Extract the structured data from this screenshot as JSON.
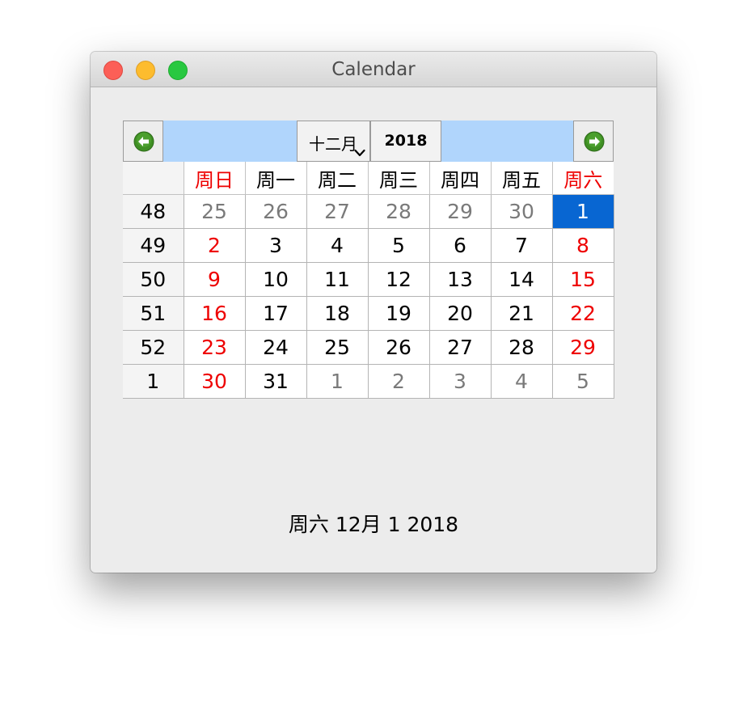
{
  "window": {
    "title": "Calendar"
  },
  "calendar": {
    "month_label": "十二月",
    "year_label": "2018",
    "weekday_headers": [
      "周日",
      "周一",
      "周二",
      "周三",
      "周四",
      "周五",
      "周六"
    ],
    "rows": [
      {
        "week": "48",
        "days": [
          {
            "d": "25",
            "kind": "other"
          },
          {
            "d": "26",
            "kind": "other"
          },
          {
            "d": "27",
            "kind": "other"
          },
          {
            "d": "28",
            "kind": "other"
          },
          {
            "d": "29",
            "kind": "other"
          },
          {
            "d": "30",
            "kind": "other"
          },
          {
            "d": "1",
            "kind": "selected"
          }
        ]
      },
      {
        "week": "49",
        "days": [
          {
            "d": "2",
            "kind": "weekend"
          },
          {
            "d": "3",
            "kind": "normal"
          },
          {
            "d": "4",
            "kind": "normal"
          },
          {
            "d": "5",
            "kind": "normal"
          },
          {
            "d": "6",
            "kind": "normal"
          },
          {
            "d": "7",
            "kind": "normal"
          },
          {
            "d": "8",
            "kind": "weekend"
          }
        ]
      },
      {
        "week": "50",
        "days": [
          {
            "d": "9",
            "kind": "weekend"
          },
          {
            "d": "10",
            "kind": "normal"
          },
          {
            "d": "11",
            "kind": "normal"
          },
          {
            "d": "12",
            "kind": "normal"
          },
          {
            "d": "13",
            "kind": "normal"
          },
          {
            "d": "14",
            "kind": "normal"
          },
          {
            "d": "15",
            "kind": "weekend"
          }
        ]
      },
      {
        "week": "51",
        "days": [
          {
            "d": "16",
            "kind": "weekend"
          },
          {
            "d": "17",
            "kind": "normal"
          },
          {
            "d": "18",
            "kind": "normal"
          },
          {
            "d": "19",
            "kind": "normal"
          },
          {
            "d": "20",
            "kind": "normal"
          },
          {
            "d": "21",
            "kind": "normal"
          },
          {
            "d": "22",
            "kind": "weekend"
          }
        ]
      },
      {
        "week": "52",
        "days": [
          {
            "d": "23",
            "kind": "weekend"
          },
          {
            "d": "24",
            "kind": "normal"
          },
          {
            "d": "25",
            "kind": "normal"
          },
          {
            "d": "26",
            "kind": "normal"
          },
          {
            "d": "27",
            "kind": "normal"
          },
          {
            "d": "28",
            "kind": "normal"
          },
          {
            "d": "29",
            "kind": "weekend"
          }
        ]
      },
      {
        "week": "1",
        "days": [
          {
            "d": "30",
            "kind": "weekend"
          },
          {
            "d": "31",
            "kind": "normal"
          },
          {
            "d": "1",
            "kind": "other"
          },
          {
            "d": "2",
            "kind": "other"
          },
          {
            "d": "3",
            "kind": "other"
          },
          {
            "d": "4",
            "kind": "other"
          },
          {
            "d": "5",
            "kind": "other"
          }
        ]
      }
    ]
  },
  "status": {
    "selected_date_text": "周六 12月 1 2018"
  },
  "colors": {
    "weekend": "#ee0000",
    "other_month": "#7a7a7a",
    "selected_bg": "#0866d2",
    "nav_bar_bg": "#b0d5fc",
    "arrow_green": "#3f8f24"
  },
  "icons": {
    "prev": "arrow-left-circle-icon",
    "next": "arrow-right-circle-icon",
    "month_dropdown": "chevron-down-icon"
  }
}
